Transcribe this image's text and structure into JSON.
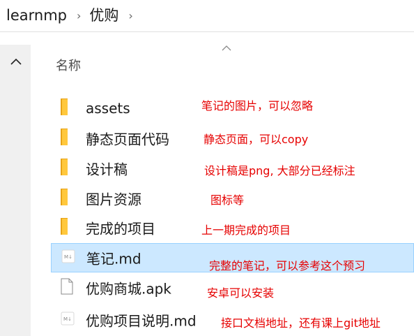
{
  "breadcrumb": {
    "items": [
      "learnmp",
      "优购"
    ],
    "separator": "›",
    "trailing_separator": "›"
  },
  "list": {
    "column_name": "名称",
    "items": [
      {
        "name": "assets",
        "type": "folder",
        "note": "笔记的图片，可以忽略"
      },
      {
        "name": "静态页面代码",
        "type": "folder",
        "note": "静态页面，可以copy"
      },
      {
        "name": "设计稿",
        "type": "folder",
        "note": "设计稿是png, 大部分已经标注"
      },
      {
        "name": "图片资源",
        "type": "folder",
        "note": "图标等"
      },
      {
        "name": "完成的项目",
        "type": "folder",
        "note": "上一期完成的项目"
      },
      {
        "name": "笔记.md",
        "type": "markdown",
        "note": "完整的笔记，可以参考这个预习",
        "selected": true
      },
      {
        "name": "优购商城.apk",
        "type": "file",
        "note": "安卓可以安装"
      },
      {
        "name": "优购项目说明.md",
        "type": "markdown",
        "note": "接口文档地址，还有课上git地址"
      }
    ]
  },
  "colors": {
    "folder": "#ffc83d",
    "folder_back": "#e8a317",
    "selection_bg": "#cce8ff",
    "selection_border": "#99d1ff",
    "note_text": "#e60000"
  },
  "icons": {
    "folder": "folder-icon",
    "markdown": "markdown-file-icon",
    "file": "blank-file-icon",
    "up": "chevron-up-icon",
    "sort": "sort-chevron-icon"
  }
}
